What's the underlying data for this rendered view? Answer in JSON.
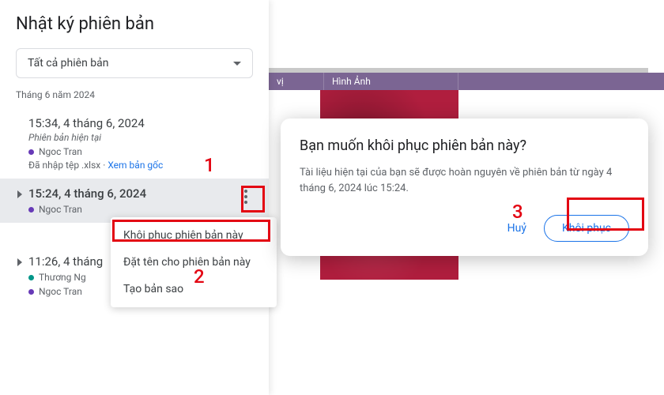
{
  "panel": {
    "title": "Nhật ký phiên bản",
    "filter_label": "Tất cả phiên bản",
    "month": "Tháng 6 năm 2024"
  },
  "versions": [
    {
      "time": "15:34, 4 tháng 6, 2024",
      "subtitle": "Phiên bản hiện tại",
      "users": [
        {
          "name": "Ngoc Tran",
          "color": "purple"
        }
      ],
      "note_prefix": "Đã nhập tệp .xlsx · ",
      "note_link": "Xem bản gốc"
    },
    {
      "time": "15:24, 4 tháng 6, 2024",
      "users": [
        {
          "name": "Ngoc Tran",
          "color": "purple"
        }
      ]
    },
    {
      "time": "11:26, 4 tháng",
      "users": [
        {
          "name": "Thương Ng",
          "color": "teal"
        },
        {
          "name": "Ngoc Tran",
          "color": "purple"
        }
      ]
    }
  ],
  "context_menu": {
    "restore": "Khôi phục phiên bản này",
    "rename": "Đặt tên cho phiên bản này",
    "copy": "Tạo bản sao"
  },
  "sheet": {
    "col1": "vị",
    "col2": "Hình Ảnh"
  },
  "dialog": {
    "title": "Bạn muốn khôi phục phiên bản này?",
    "body": "Tài liệu hiện tại của bạn sẽ được hoàn nguyên về phiên bản từ ngày 4 tháng 6, 2024 lúc 15:24.",
    "cancel": "Huỷ",
    "restore": "Khôi phục"
  },
  "annotations": {
    "n1": "1",
    "n2": "2",
    "n3": "3"
  }
}
